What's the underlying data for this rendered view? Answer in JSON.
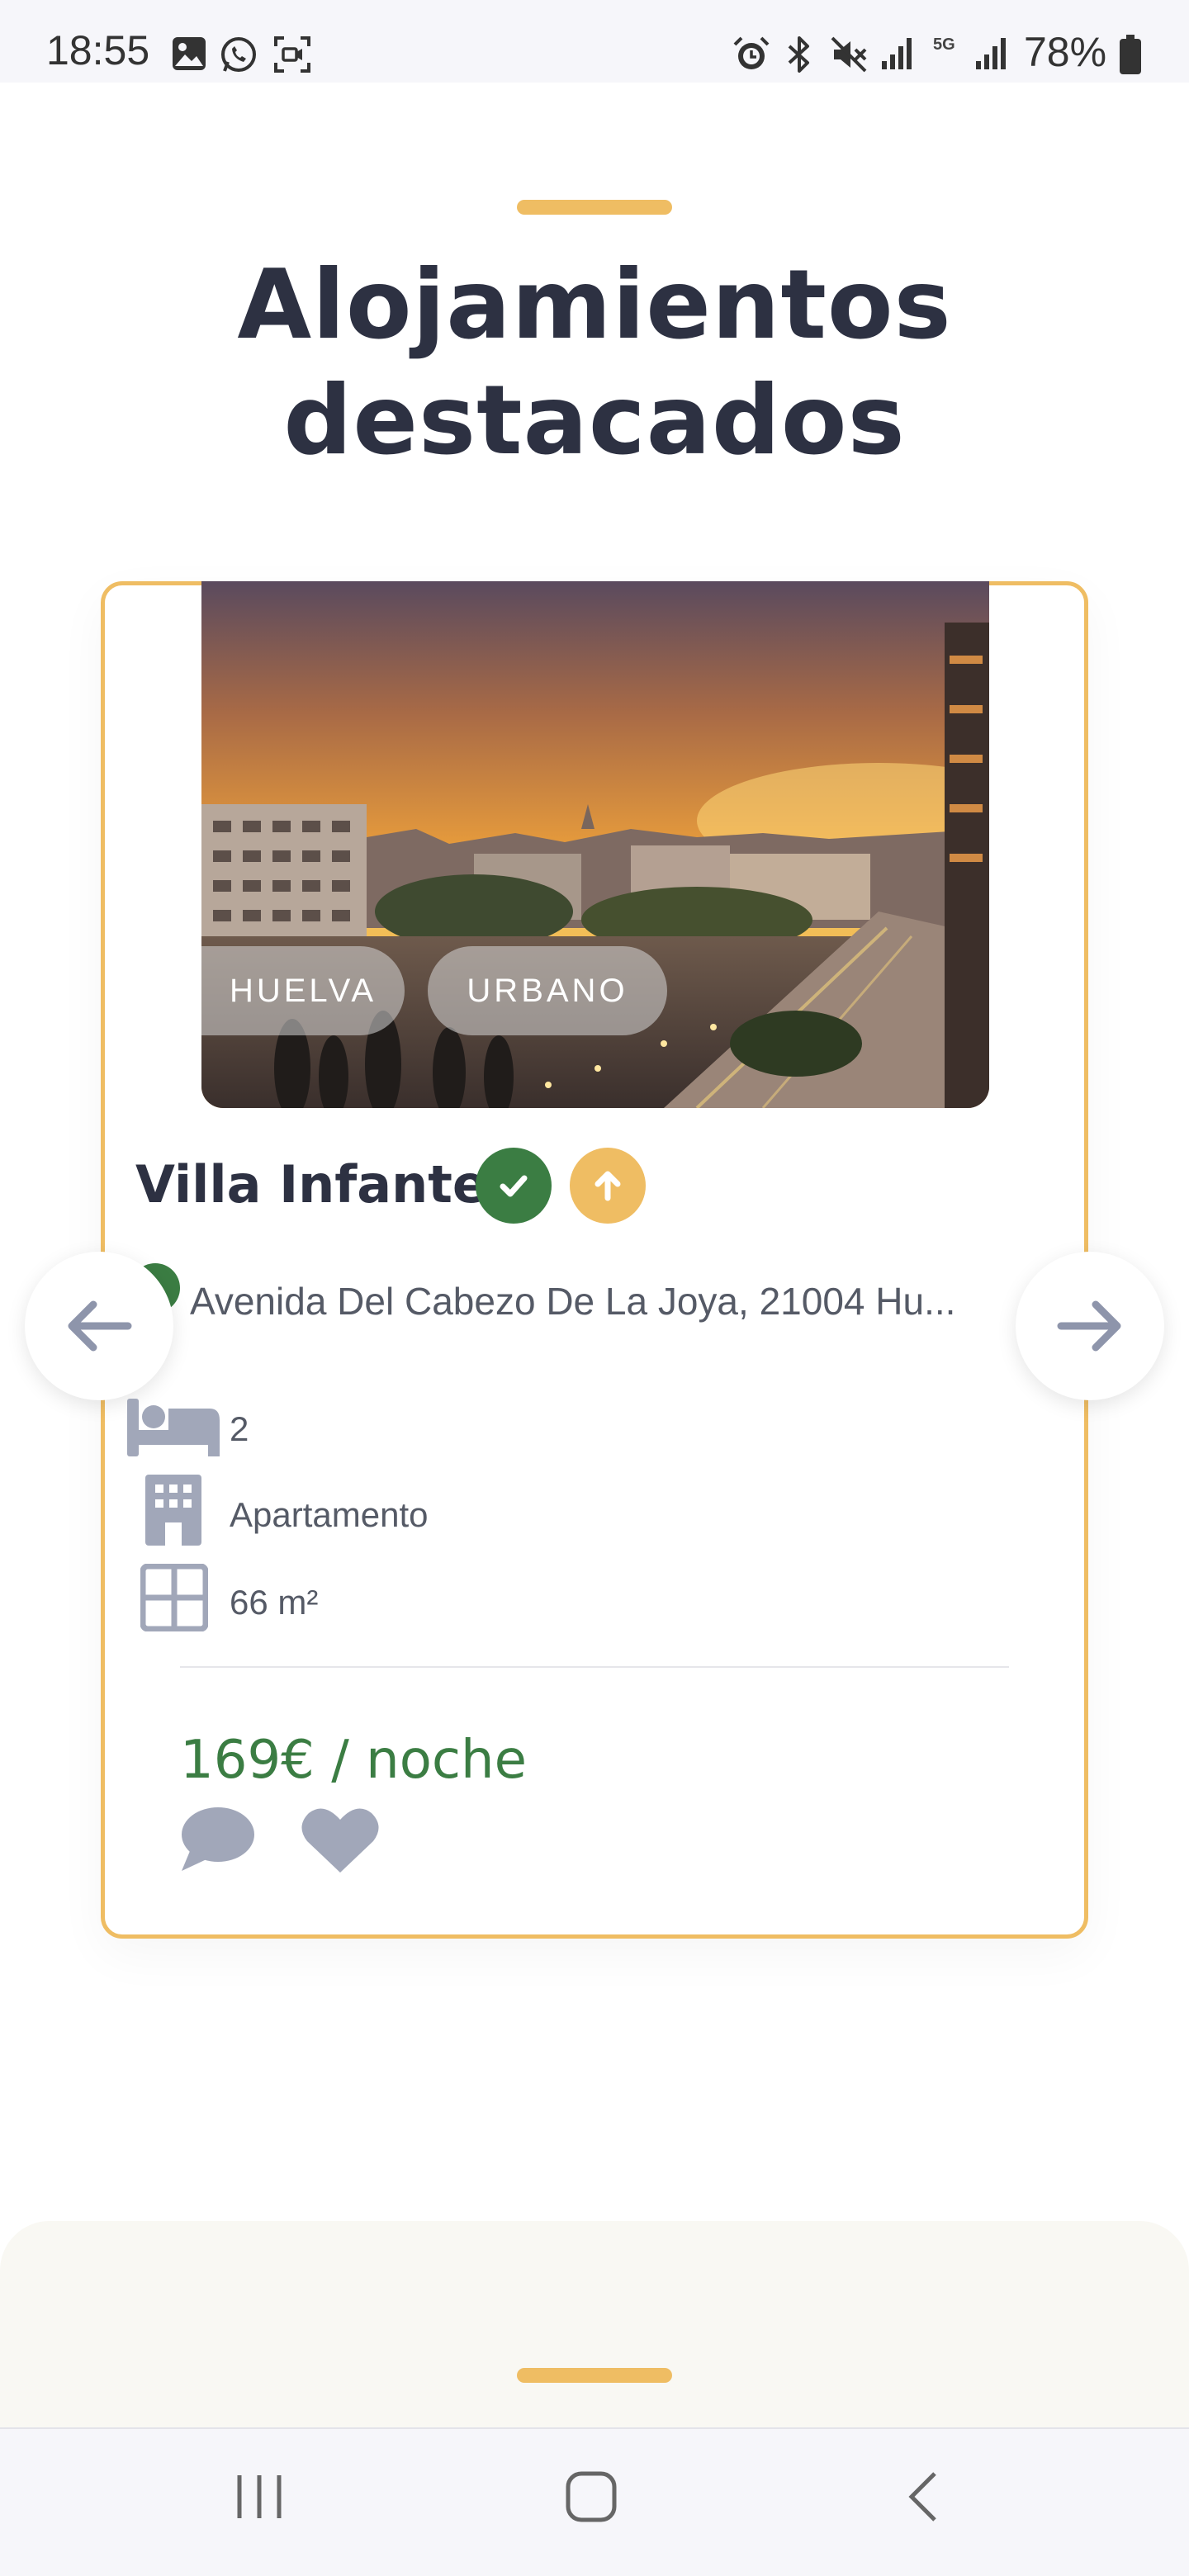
{
  "status_bar": {
    "time": "18:55",
    "network": "5G",
    "battery": "78%"
  },
  "section": {
    "title_line1": "Alojamientos",
    "title_line2": "destacados"
  },
  "listing": {
    "tags": [
      "HUELVA",
      "URBANO"
    ],
    "title": "Villa Infante",
    "address": "Avenida Del Cabezo De La Joya, 21004 Hu...",
    "features": {
      "beds": "2",
      "type": "Apartamento",
      "area": "66 m²"
    },
    "price": "169€ / noche"
  },
  "colors": {
    "accent": "#efbd63",
    "green": "#3b7d43",
    "title": "#2d3142",
    "icon_gray": "#a1a7b9"
  },
  "icons": {
    "prev": "arrow-left-icon",
    "next": "arrow-right-icon",
    "verified": "check-circle-icon",
    "featured": "arrow-up-circle-icon",
    "bed": "bed-icon",
    "building": "building-icon",
    "area": "grid-icon",
    "comment": "comment-icon",
    "favorite": "heart-icon"
  }
}
